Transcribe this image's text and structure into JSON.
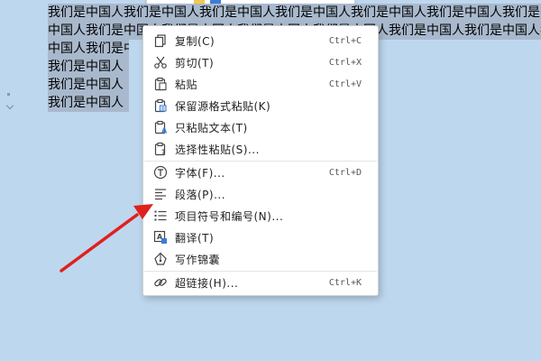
{
  "document": {
    "lines": [
      "我们是中国人我们是中国人我们是中国人我们是中国人我们是中国人我们是中国人我们是中",
      "中国人我们是中国人我们是中国人我们是中国人我们是中国人我们是中国人我们是中国人我",
      "中国人我们是中国人",
      "我们是中国人",
      "我们是中国人",
      "我们是中国人"
    ]
  },
  "context_menu": {
    "items": [
      {
        "label": "复制(C)",
        "shortcut": "Ctrl+C",
        "icon": "copy-icon"
      },
      {
        "label": "剪切(T)",
        "shortcut": "Ctrl+X",
        "icon": "scissors-icon"
      },
      {
        "label": "粘贴",
        "shortcut": "Ctrl+V",
        "icon": "paste-icon"
      },
      {
        "label": "保留源格式粘贴(K)",
        "shortcut": "",
        "icon": "paste-keep-format-icon"
      },
      {
        "label": "只粘贴文本(T)",
        "shortcut": "",
        "icon": "paste-text-only-icon"
      },
      {
        "label": "选择性粘贴(S)...",
        "shortcut": "",
        "icon": "paste-special-icon"
      },
      {
        "label": "字体(F)...",
        "shortcut": "Ctrl+D",
        "icon": "font-icon"
      },
      {
        "label": "段落(P)...",
        "shortcut": "",
        "icon": "paragraph-icon"
      },
      {
        "label": "项目符号和编号(N)...",
        "shortcut": "",
        "icon": "bullets-numbering-icon"
      },
      {
        "label": "翻译(T)",
        "shortcut": "",
        "icon": "translate-icon"
      },
      {
        "label": "写作锦囊",
        "shortcut": "",
        "icon": "writing-tips-icon"
      },
      {
        "label": "超链接(H)...",
        "shortcut": "Ctrl+K",
        "icon": "hyperlink-icon"
      }
    ]
  },
  "colors": {
    "background": "#bdd7ee",
    "selection": "#a9b9cd",
    "arrow": "#e0201b",
    "accent_blue": "#3b7dd8"
  }
}
